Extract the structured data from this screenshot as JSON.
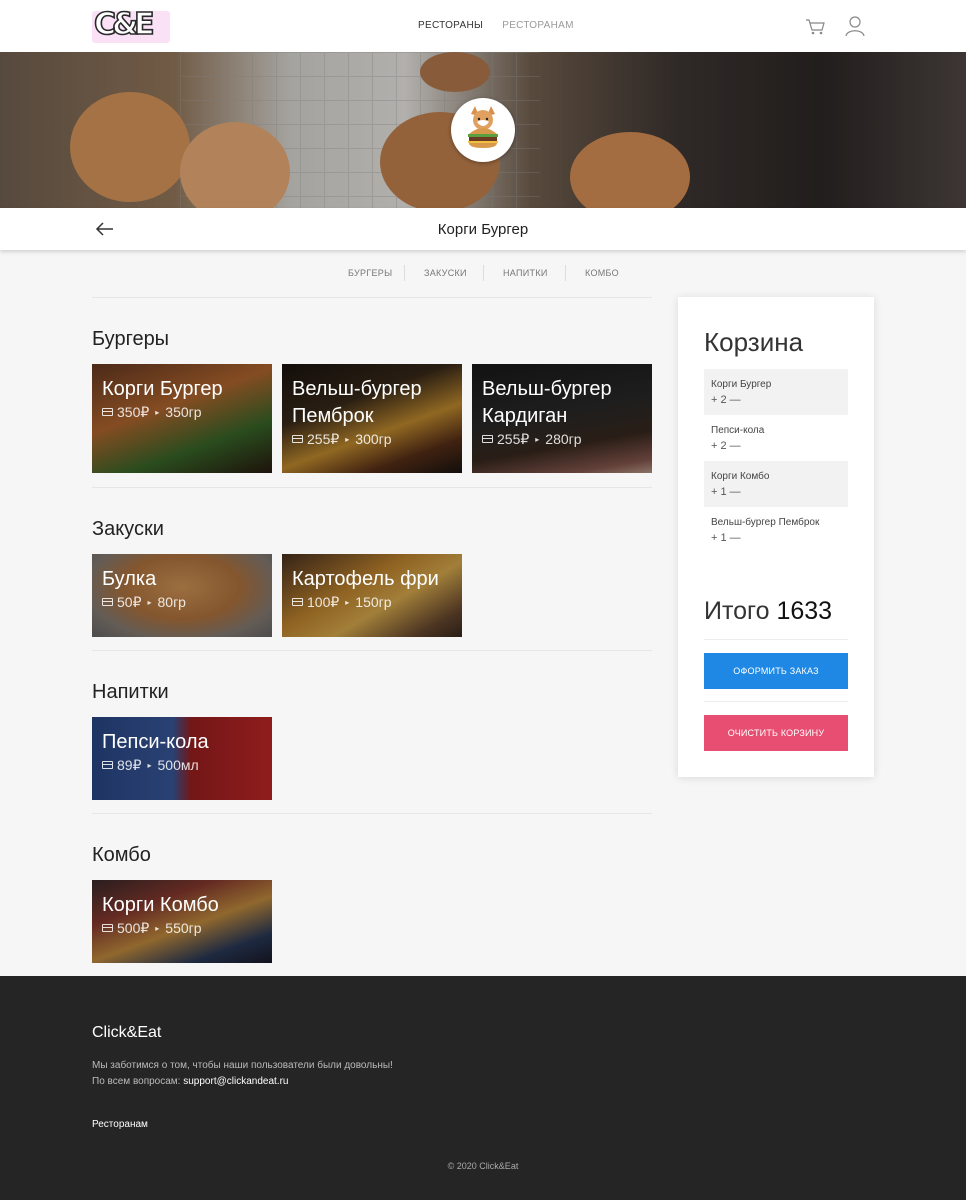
{
  "header": {
    "logo_text": "C&E",
    "nav": [
      "Рестораны",
      "Ресторанам"
    ],
    "icons": [
      "cart-icon",
      "user-icon"
    ]
  },
  "restaurant": {
    "title": "Корги Бургер"
  },
  "categories": [
    "Бургеры",
    "Закуски",
    "Напитки",
    "Комбо"
  ],
  "sections": [
    {
      "title": "Бургеры",
      "items": [
        {
          "name": "Корги Бургер",
          "price": "350₽",
          "weight": "350гр"
        },
        {
          "name": "Вельш-бургер Пемброк",
          "price": "255₽",
          "weight": "300гр"
        },
        {
          "name": "Вельш-бургер Кардиган",
          "price": "255₽",
          "weight": "280гр"
        }
      ]
    },
    {
      "title": "Закуски",
      "items": [
        {
          "name": "Булка",
          "price": "50₽",
          "weight": "80гр"
        },
        {
          "name": "Картофель фри",
          "price": "100₽",
          "weight": "150гр"
        }
      ]
    },
    {
      "title": "Напитки",
      "items": [
        {
          "name": "Пепси-кола",
          "price": "89₽",
          "weight": "500мл"
        }
      ]
    },
    {
      "title": "Комбо",
      "items": [
        {
          "name": "Корги Комбо",
          "price": "500₽",
          "weight": "550гр"
        }
      ]
    }
  ],
  "cart": {
    "title": "Корзина",
    "items": [
      {
        "name": "Корги Бургер",
        "qty": "2"
      },
      {
        "name": "Пепси-кола",
        "qty": "2"
      },
      {
        "name": "Корги Комбо",
        "qty": "1"
      },
      {
        "name": "Вельш-бургер Пемброк",
        "qty": "1"
      }
    ],
    "plus": "+",
    "minus": "—",
    "total_label": "Итого",
    "total_value": "1633",
    "checkout_label": "Оформить заказ",
    "clear_label": "Очистить корзину"
  },
  "footer": {
    "brand": "Click&Eat",
    "line1": "Мы заботимся о том, чтобы наши пользователи были довольны!",
    "line2_prefix": "По всем вопросам:",
    "email": "support@clickandeat.ru",
    "link": "Ресторанам",
    "copyright": "© 2020 Click&Eat"
  },
  "colors": {
    "primary": "#1f88e5",
    "danger": "#e84e72",
    "footer_bg": "#252525"
  }
}
